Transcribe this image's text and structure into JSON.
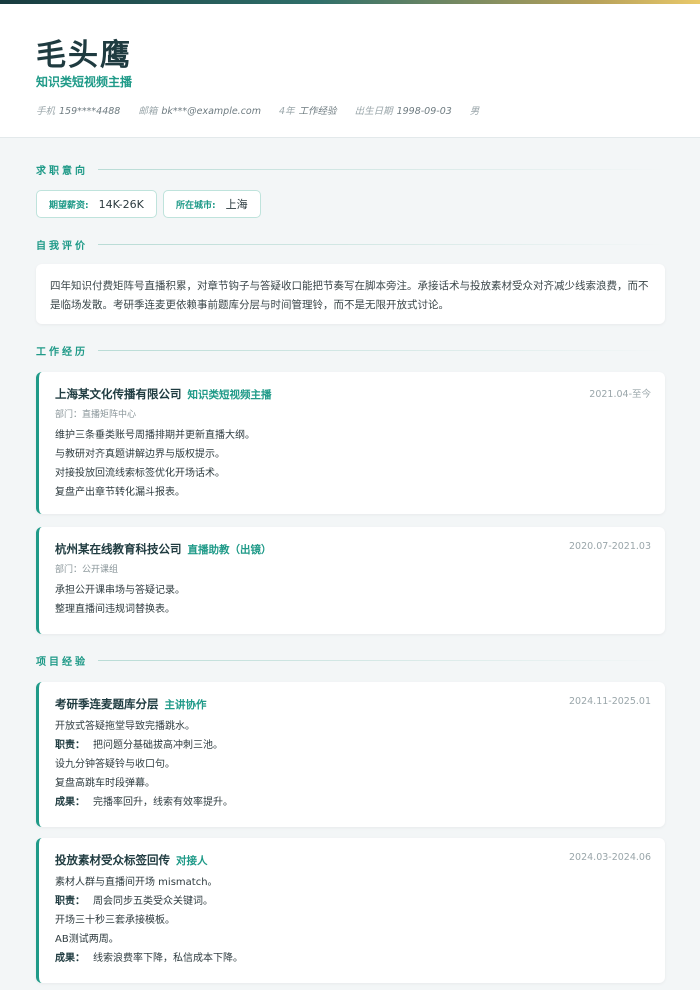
{
  "header": {
    "name": "毛头鹰",
    "role": "知识类短视频主播",
    "phone_label": "手机",
    "phone": "159****4488",
    "email_label": "邮箱",
    "email": "bk***@example.com",
    "years_label": "4年",
    "years": "工作经验",
    "birth_label": "出生日期",
    "birth": "1998-09-03",
    "gender": "男"
  },
  "sections": {
    "intent": "求职意向",
    "self": "自我评价",
    "work": "工作经历",
    "project": "项目经验"
  },
  "intent": {
    "salary_label": "期望薪资:",
    "salary": "14K-26K",
    "city_label": "所在城市:",
    "city": "上海"
  },
  "summary": "四年知识付费矩阵号直播积累，对章节钩子与答疑收口能把节奏写在脚本旁注。承接话术与投放素材受众对齐减少线索浪费，而不是临场发散。考研季连麦更依赖事前题库分层与时间管理铃，而不是无限开放式讨论。",
  "work": [
    {
      "company": "上海某文化传播有限公司",
      "title": "知识类短视频主播",
      "date": "2021.04-至今",
      "dept": "部门：直播矩阵中心",
      "items": [
        "维护三条垂类账号周播排期并更新直播大纲。",
        "与教研对齐真题讲解边界与版权提示。",
        "对接投放回流线索标签优化开场话术。",
        "复盘产出章节转化漏斗报表。"
      ]
    },
    {
      "company": "杭州某在线教育科技公司",
      "title": "直播助教（出镜）",
      "date": "2020.07-2021.03",
      "dept": "部门：公开课组",
      "items": [
        "承担公开课串场与答疑记录。",
        "整理直播间违规词替换表。"
      ]
    }
  ],
  "projects": [
    {
      "name": "考研季连麦题库分层",
      "role": "主讲协作",
      "date": "2024.11-2025.01",
      "desc": "开放式答疑拖堂导致完播跳水。",
      "duty_label": "职责：",
      "duty": "把问题分基础拔高冲刺三池。",
      "extra": [
        "设九分钟答疑铃与收口句。",
        "复盘高跳车时段弹幕。"
      ],
      "result_label": "成果：",
      "result": "完播率回升，线索有效率提升。"
    },
    {
      "name": "投放素材受众标签回传",
      "role": "对接人",
      "date": "2024.03-2024.06",
      "desc": "素材人群与直播间开场 mismatch。",
      "duty_label": "职责：",
      "duty": "周会同步五类受众关键词。",
      "extra": [
        "开场三十秒三套承接模板。",
        "AB测试两周。"
      ],
      "result_label": "成果：",
      "result": "线索浪费率下降，私信成本下降。"
    }
  ]
}
